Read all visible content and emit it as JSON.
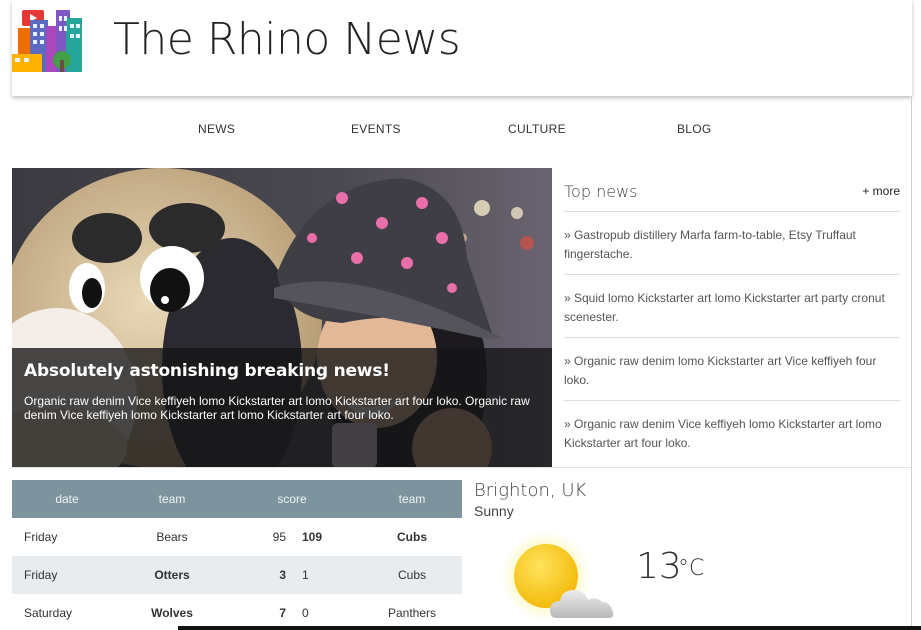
{
  "header": {
    "title": "The Rhino News",
    "logo_icon": "city-buildings-logo-icon"
  },
  "nav": {
    "items": [
      {
        "label": "NEWS"
      },
      {
        "label": "EVENTS"
      },
      {
        "label": "CULTURE"
      },
      {
        "label": "BLOG"
      }
    ]
  },
  "hero": {
    "title": "Absolutely astonishing breaking news!",
    "text": "Organic raw denim Vice keffiyeh lomo Kickstarter art lomo Kickstarter art four loko. Organic raw denim Vice keffiyeh lomo Kickstarter art lomo Kickstarter art four loko."
  },
  "top_news": {
    "title": "Top news",
    "more_label": "+ more",
    "items": [
      {
        "text": "» Gastropub distillery Marfa farm-to-table, Etsy Truffaut fingerstache."
      },
      {
        "text": "» Squid lomo Kickstarter art lomo Kickstarter art party cronut scenester."
      },
      {
        "text": "» Organic raw denim lomo Kickstarter art Vice keffiyeh four loko."
      },
      {
        "text": "» Organic raw denim Vice keffiyeh lomo Kickstarter art lomo Kickstarter art four loko."
      }
    ]
  },
  "scores": {
    "headers": {
      "date": "date",
      "team1": "team",
      "score": "score",
      "team2": "team"
    },
    "rows": [
      {
        "date": "Friday",
        "team1": "Bears",
        "s1": "95",
        "s2": "109",
        "team2": "Cubs",
        "winner": 2
      },
      {
        "date": "Friday",
        "team1": "Otters",
        "s1": "3",
        "s2": "1",
        "team2": "Cubs",
        "winner": 1
      },
      {
        "date": "Saturday",
        "team1": "Wolves",
        "s1": "7",
        "s2": "0",
        "team2": "Panthers",
        "winner": 1
      }
    ]
  },
  "weather": {
    "city": "Brighton, UK",
    "condition": "Sunny",
    "temperature": "13",
    "unit": "°C",
    "icon": "sun-cloud-icon"
  }
}
